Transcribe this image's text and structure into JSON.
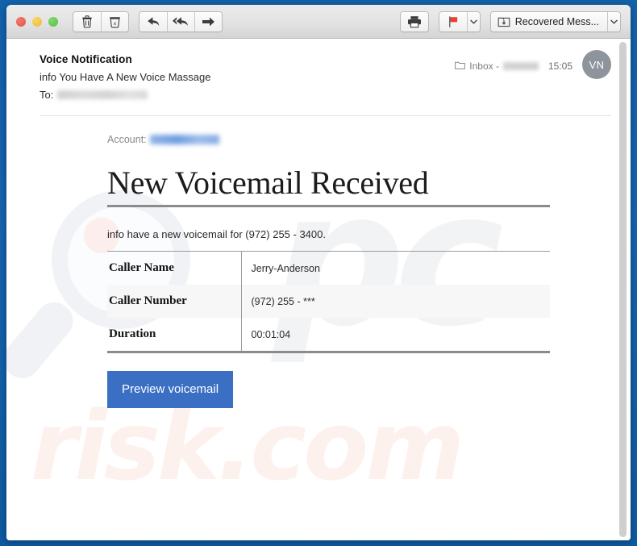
{
  "window": {
    "traffic_lights": [
      {
        "name": "close",
        "color": "#e0524b"
      },
      {
        "name": "minimize",
        "color": "#eebb32"
      },
      {
        "name": "zoom",
        "color": "#52bf45"
      }
    ]
  },
  "toolbar": {
    "delete_icon": "trash-icon",
    "junk_icon": "junk-trash-icon",
    "reply_icon": "reply-arrow-icon",
    "reply_all_icon": "reply-all-arrow-icon",
    "forward_icon": "forward-arrow-icon",
    "print_icon": "printer-icon",
    "flag_icon": "flag-icon",
    "flag_color": "#e8412e",
    "flag_caret_icon": "chevron-down-icon",
    "move_icon": "move-to-folder-icon",
    "move_label": "Recovered Mess...",
    "move_caret_icon": "chevron-down-icon"
  },
  "mail": {
    "subject": "Voice Notification",
    "sender": "info You Have A New Voice Massage",
    "to_label": "To:",
    "to_value": "",
    "mailbox_icon": "folder-icon",
    "mailbox_label": "Inbox -",
    "mailbox_account": "",
    "time": "15:05",
    "avatar_initials": "VN"
  },
  "body": {
    "account_label": "Account:",
    "account_value": "",
    "headline": "New Voicemail Received",
    "lead": "info have a new voicemail for (972) 255 - 3400.",
    "table": [
      {
        "label": "Caller Name",
        "value": "Jerry-Anderson"
      },
      {
        "label": "Caller Number",
        "value": "(972) 255 - ***"
      },
      {
        "label": "Duration",
        "value": "00:01:04"
      }
    ],
    "cta_label": "Preview voicemail",
    "cta_color": "#3a6fc4"
  },
  "watermark": {
    "brand_prefix": "pc",
    "brand_suffix": "risk.com"
  }
}
